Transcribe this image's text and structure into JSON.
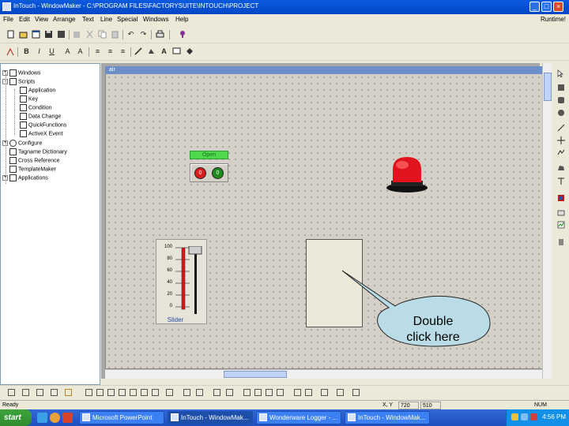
{
  "app": {
    "title": "InTouch - WindowMaker - C:\\PROGRAM FILES\\FACTORYSUITE\\INTOUCH\\PROJECT",
    "window_buttons": [
      "_",
      "□",
      "×"
    ]
  },
  "menu": {
    "items": [
      "File",
      "Edit",
      "View",
      "Arrange",
      "Text",
      "Line",
      "Special",
      "Windows",
      "Help"
    ],
    "runtime_label": "Runtime!"
  },
  "tree": {
    "items": [
      {
        "label": "Windows",
        "level": 0,
        "expander": "+"
      },
      {
        "label": "Scripts",
        "level": 0,
        "expander": "-"
      },
      {
        "label": "Application",
        "level": 1
      },
      {
        "label": "Key",
        "level": 1
      },
      {
        "label": "Condition",
        "level": 1
      },
      {
        "label": "Data Change",
        "level": 1
      },
      {
        "label": "QuickFunctions",
        "level": 1
      },
      {
        "label": "ActiveX Event",
        "level": 1
      },
      {
        "label": "Configure",
        "level": 0,
        "expander": "+"
      },
      {
        "label": "Tagname Dictionary",
        "level": 0
      },
      {
        "label": "Cross Reference",
        "level": 0
      },
      {
        "label": "TemplateMaker",
        "level": 0
      },
      {
        "label": "Applications",
        "level": 0,
        "expander": "+"
      }
    ]
  },
  "canvas": {
    "window_title": "air",
    "open_label": "Open",
    "button_red_label": "0",
    "button_green_label": "0",
    "slider": {
      "ticks": [
        "100",
        "80",
        "60",
        "40",
        "20",
        "0"
      ],
      "name": "Slider",
      "level_percent": 100
    },
    "callout": {
      "line1": "Double",
      "line2": "click here"
    }
  },
  "status": {
    "ready": "Ready",
    "xy_label": "X, Y",
    "x_value": "720",
    "y_value": "510",
    "num": "NUM"
  },
  "taskbar": {
    "start": "start",
    "buttons": [
      {
        "label": "Microsoft PowerPoint",
        "active": false
      },
      {
        "label": "InTouch - WindowMak...",
        "active": true
      },
      {
        "label": "Wonderware Logger - ...",
        "active": false
      },
      {
        "label": "InTouch - WindowMak...",
        "active": false
      }
    ],
    "clock": "4:56 PM"
  },
  "colors": {
    "title_bar": "#0a5ae0",
    "canvas_bg": "#d4d0c8",
    "alarm_red": "#e0141e",
    "open_green": "#4dd84d",
    "callout_fill": "#b9dce6"
  }
}
